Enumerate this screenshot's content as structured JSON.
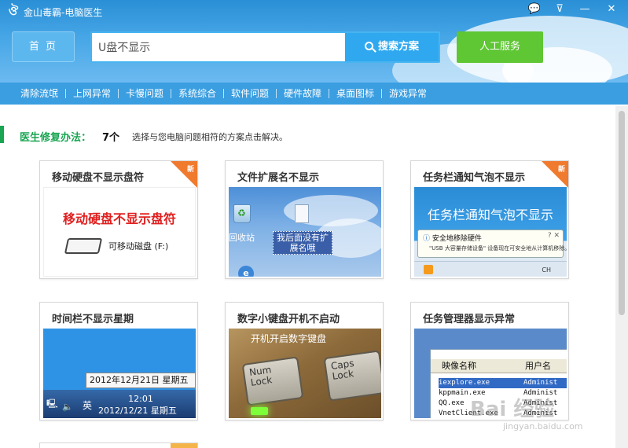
{
  "app": {
    "title": "金山毒霸-电脑医生"
  },
  "header": {
    "home_label": "首 页",
    "search_value": "U盘不显示",
    "search_button_label": "搜索方案",
    "service_button_label": "人工服务"
  },
  "categories": [
    "清除流氓",
    "上网异常",
    "卡慢问题",
    "系统综合",
    "软件问题",
    "硬件故障",
    "桌面图标",
    "游戏异常"
  ],
  "section": {
    "title": "医生修复办法：",
    "count": "7个",
    "description": "选择与您电脑问题相符的方案点击解决。"
  },
  "new_badge": "新",
  "cards": [
    {
      "title": "移动硬盘不显示盘符",
      "is_new": true,
      "image_heading": "移动硬盘不显示盘符",
      "drive_label": "可移动磁盘 (F:)"
    },
    {
      "title": "文件扩展名不显示",
      "is_new": false,
      "recycle_label": "回收站",
      "file_label": "我后面没有扩展名哦"
    },
    {
      "title": "任务栏通知气泡不显示",
      "is_new": true,
      "image_heading": "任务栏通知气泡不显示",
      "balloon_title": "安全地移除硬件",
      "balloon_text": "\"USB 大容量存储设备\" 设备现在可安全地从计算机移除。",
      "tray_text": "CH"
    },
    {
      "title": "时间栏不显示星期",
      "is_new": false,
      "tooltip": "2012年12月21日 星期五",
      "taskbar_ime": "英",
      "taskbar_time": "12:01",
      "taskbar_date": "2012/12/21 星期五"
    },
    {
      "title": "数字小键盘开机不启动",
      "is_new": false,
      "caption": "开机开启数字键盘",
      "key1": "Num Lock",
      "key2": "Caps Lock"
    },
    {
      "title": "任务管理器显示异常",
      "is_new": false,
      "col1": "映像名称",
      "col2": "用户名",
      "rows": [
        {
          "name": "iexplore.exe",
          "user": "Administ"
        },
        {
          "name": "kppmain.exe",
          "user": "Administ"
        },
        {
          "name": "QQ.exe",
          "user": "Administ"
        },
        {
          "name": "VnetClient.exe",
          "user": "Administ"
        }
      ]
    }
  ],
  "watermark": {
    "main": "Bai 经验",
    "sub": "jingyan.baidu.com"
  }
}
